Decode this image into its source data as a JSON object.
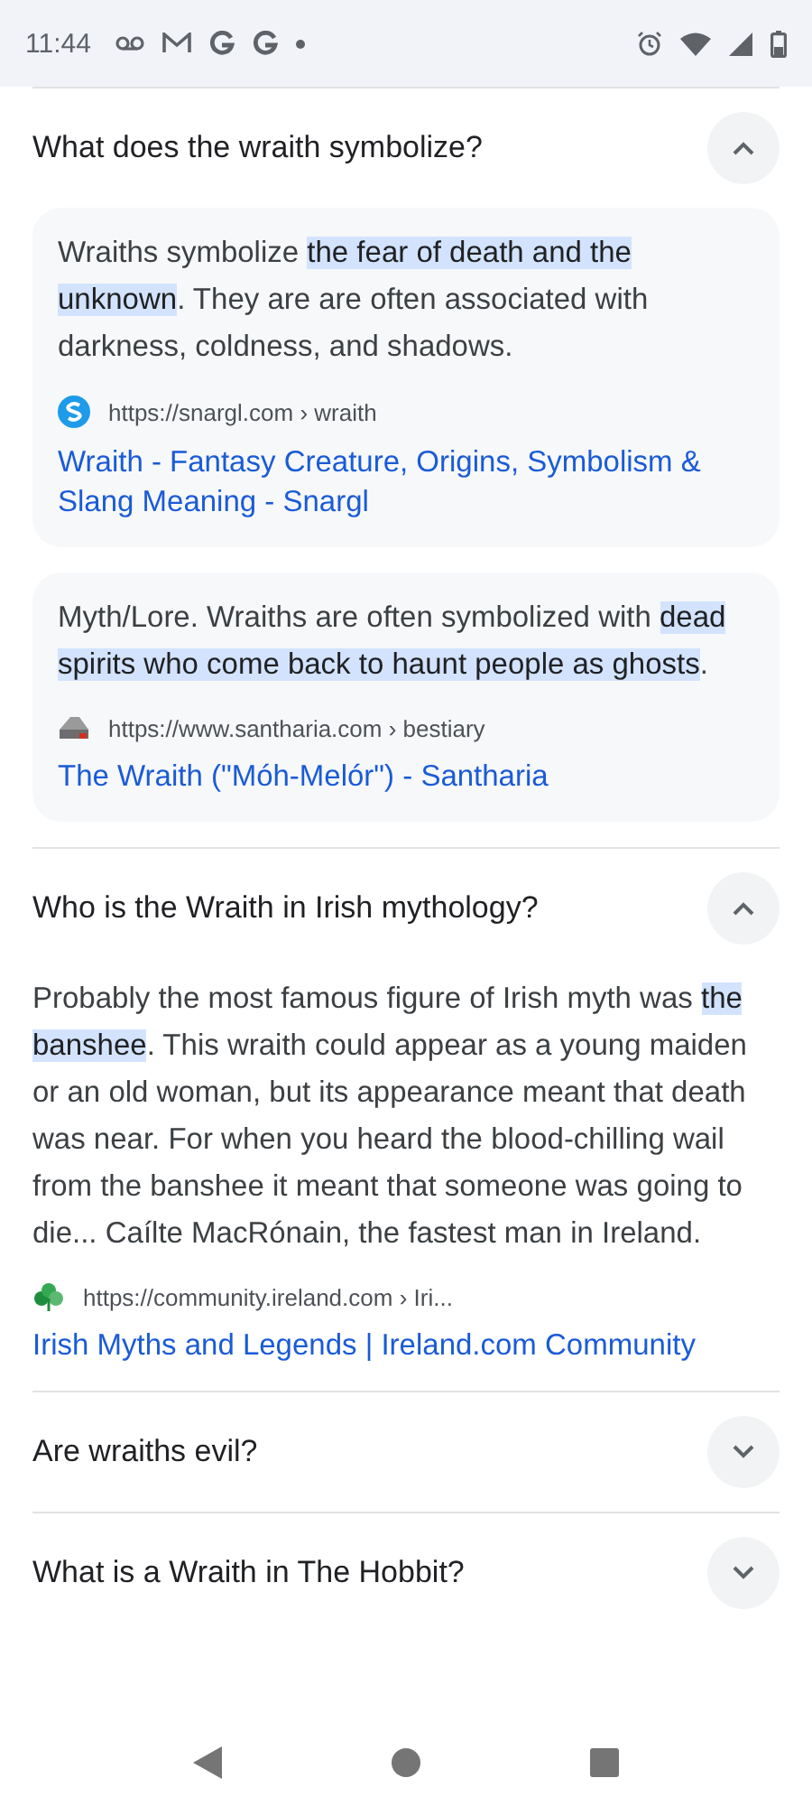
{
  "status_bar": {
    "time": "11:44"
  },
  "faq": [
    {
      "question": "What does the wraith symbolize?",
      "expanded": true,
      "answers": [
        {
          "kind": "card",
          "text": "Wraiths symbolize **the fear of death and the unknown**. They are are often associated with darkness, coldness, and shadows.",
          "source": "https://snargl.com › wraith",
          "link": "Wraith - Fantasy Creature, Origins, Symbolism & Slang Meaning - Snargl"
        },
        {
          "kind": "card",
          "text": "Myth/Lore. Wraiths are often symbolized with **dead spirits who come back to haunt people as ghosts**.",
          "source": "https://www.santharia.com › bestiary",
          "link": "The Wraith (\"Móh-Melór\") - Santharia"
        }
      ]
    },
    {
      "question": "Who is the Wraith in Irish mythology?",
      "expanded": true,
      "answers": [
        {
          "kind": "plain",
          "text": "Probably the most famous figure of Irish myth was **the banshee**. This wraith could appear as a young maiden or an old woman, but its appearance meant that death was near. For when you heard the blood-chilling wail from the banshee it meant that someone was going to die... Caílte MacRónain, the fastest man in Ireland.",
          "source": "https://community.ireland.com › Iri...",
          "link": "Irish Myths and Legends | Ireland.com Community"
        }
      ]
    },
    {
      "question": "Are wraiths evil?",
      "expanded": false
    },
    {
      "question": "What is a Wraith in The Hobbit?",
      "expanded": false
    }
  ]
}
